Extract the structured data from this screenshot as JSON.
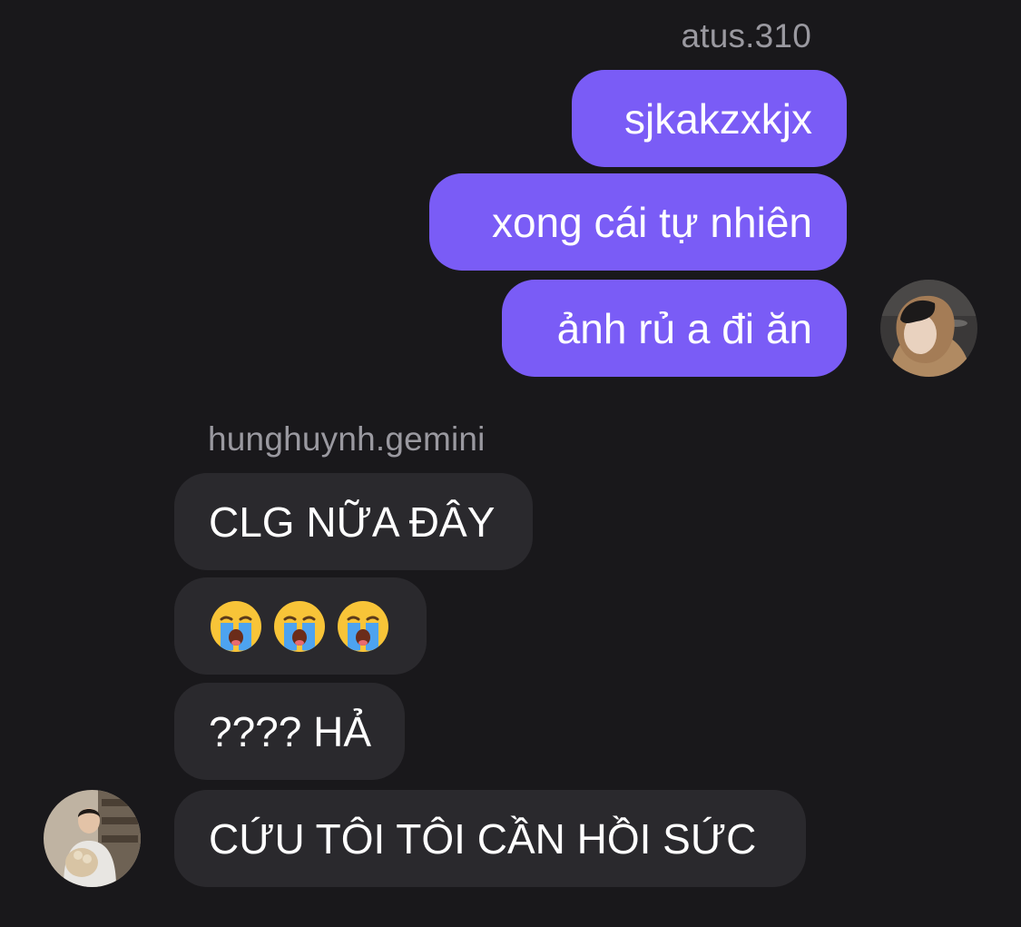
{
  "outgoing": {
    "sender": "atus.310",
    "messages": [
      "sjkakzxkjx",
      "xong cái tự nhiên",
      "ảnh rủ a đi ăn"
    ]
  },
  "incoming": {
    "sender": "hunghuynh.gemini",
    "messages": [
      "CLG NỮA ĐÂY",
      "😭😭😭",
      "???? HẢ",
      "CỨU TÔI TÔI CẦN HỒI SỨC"
    ]
  },
  "icons": {
    "emoji": "loudly-crying-face-icon",
    "avatars": [
      "outgoing-user-avatar",
      "incoming-user-avatar"
    ]
  },
  "colors": {
    "background": "#19181b",
    "outgoing_bubble": "#7a5cf6",
    "incoming_bubble": "#2a292d",
    "sender_name": "#9a99a0",
    "text": "#ffffff"
  }
}
